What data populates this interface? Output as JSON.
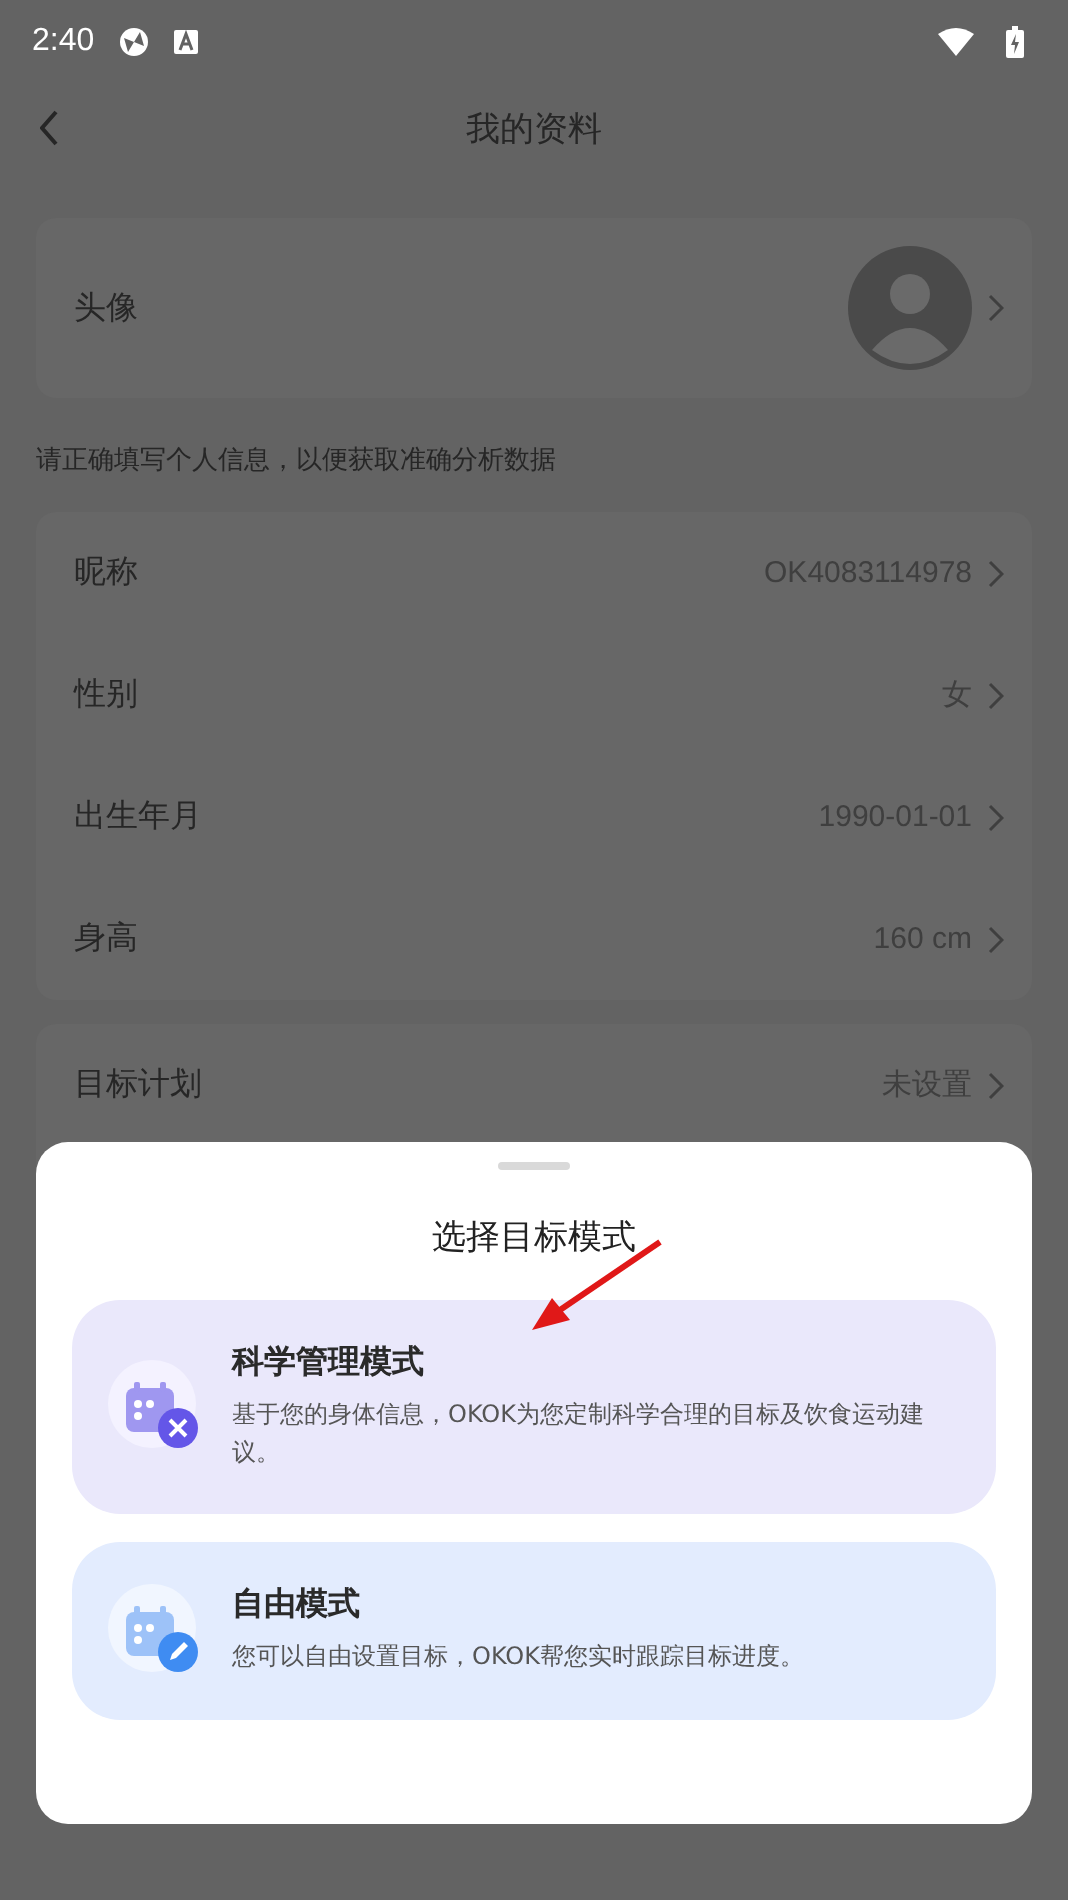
{
  "status_bar": {
    "time": "2:40"
  },
  "header": {
    "title": "我的资料"
  },
  "avatar_row": {
    "label": "头像"
  },
  "hint": "请正确填写个人信息，以便获取准确分析数据",
  "profile_rows": [
    {
      "label": "昵称",
      "value": "OK4083114978"
    },
    {
      "label": "性别",
      "value": "女"
    },
    {
      "label": "出生年月",
      "value": "1990-01-01"
    },
    {
      "label": "身高",
      "value": "160 cm"
    }
  ],
  "goal_row": {
    "label": "目标计划",
    "value": "未设置"
  },
  "sheet": {
    "title": "选择目标模式",
    "options": [
      {
        "kind": "science",
        "title": "科学管理模式",
        "description": "基于您的身体信息，OKOK为您定制科学合理的目标及饮食运动建议。"
      },
      {
        "kind": "free",
        "title": "自由模式",
        "description": "您可以自由设置目标，OKOK帮您实时跟踪目标进度。"
      }
    ]
  }
}
